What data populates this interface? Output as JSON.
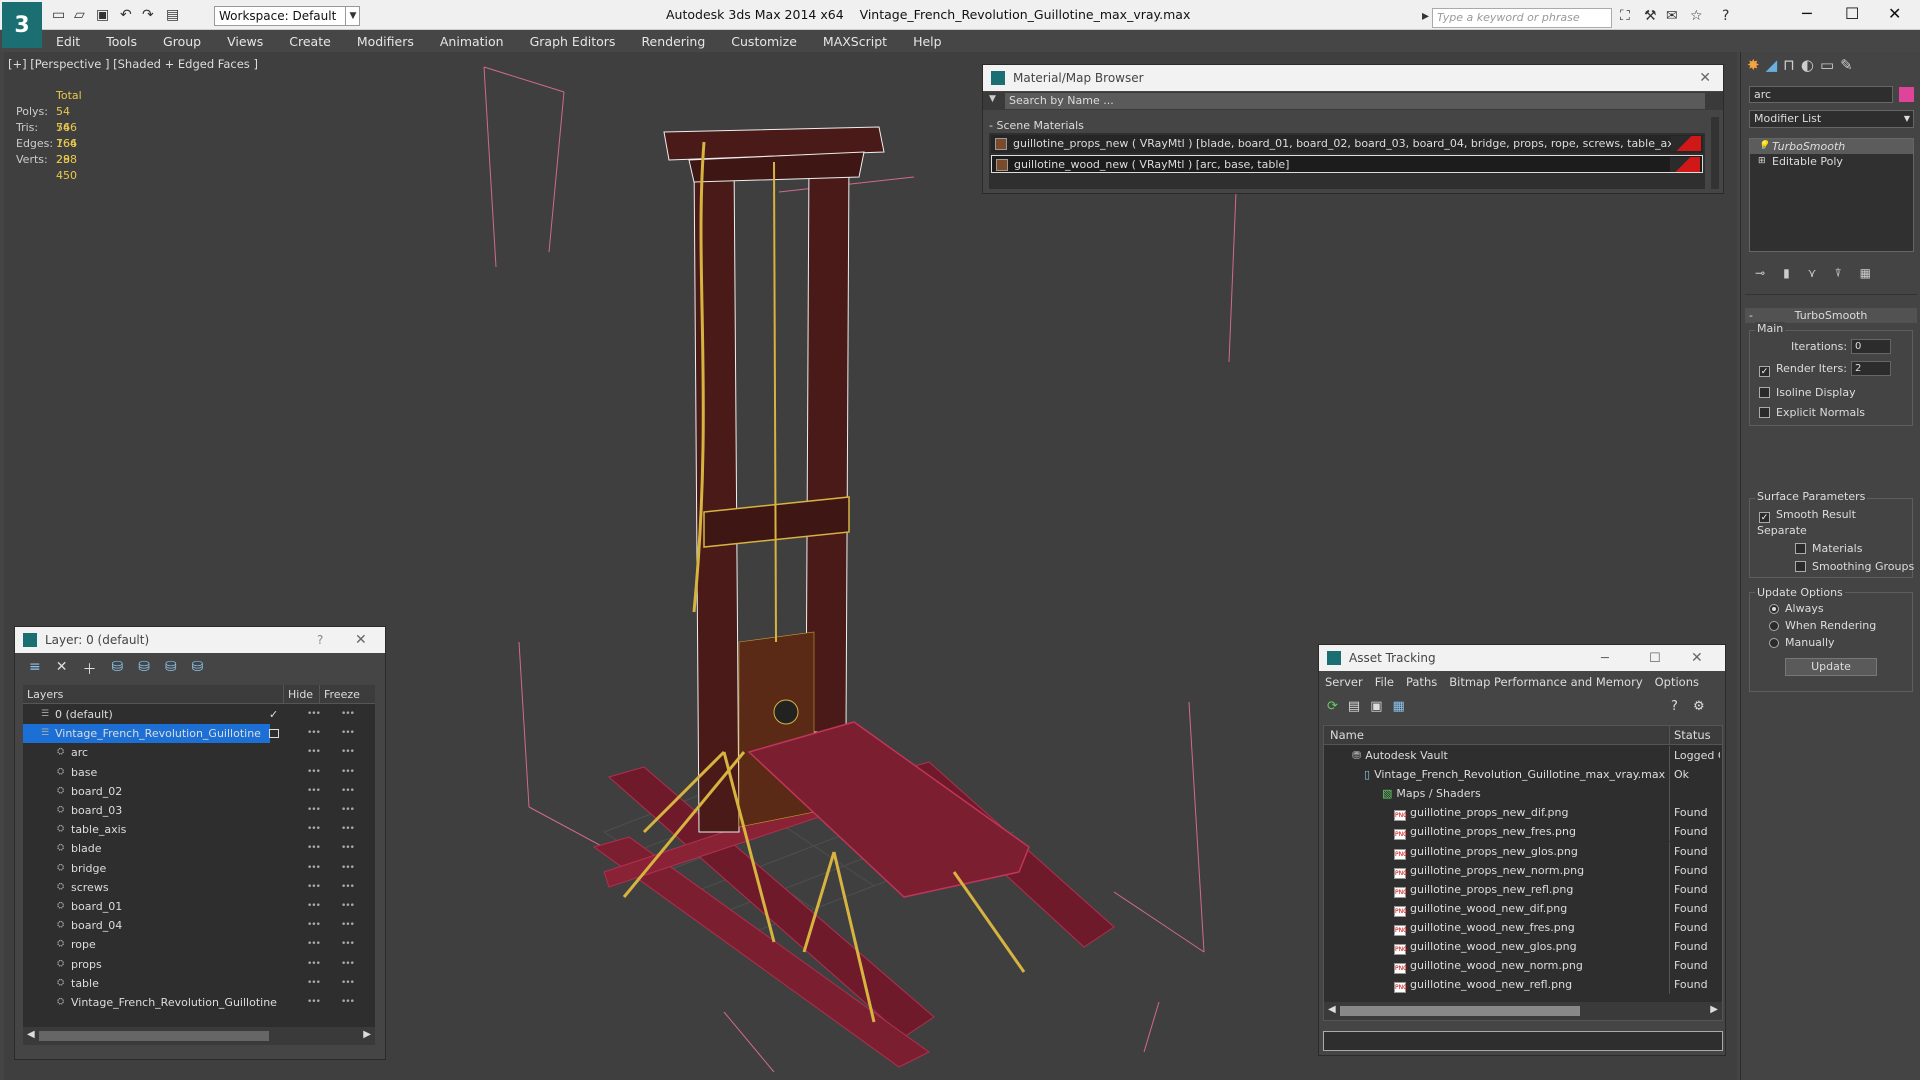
{
  "window": {
    "app_title": "Autodesk 3ds Max  2014 x64",
    "file_title": "Vintage_French_Revolution_Guillotine_max_vray.max",
    "workspace": "Workspace: Default",
    "search_placeholder": "Type a keyword or phrase"
  },
  "menu": [
    "Edit",
    "Tools",
    "Group",
    "Views",
    "Create",
    "Modifiers",
    "Animation",
    "Graph Editors",
    "Rendering",
    "Customize",
    "MAXScript",
    "Help"
  ],
  "viewport": {
    "label": "[+] [Perspective ] [Shaded + Edged Faces ]",
    "stats_header": "Total",
    "stats": [
      {
        "label": "Polys:",
        "value": "54 766"
      },
      {
        "label": "Tris:",
        "value": "54 766"
      },
      {
        "label": "Edges:",
        "value": "164 298"
      },
      {
        "label": "Verts:",
        "value": "28 450"
      }
    ]
  },
  "material_browser": {
    "title": "Material/Map Browser",
    "search_placeholder": "Search by Name ...",
    "section": "- Scene Materials",
    "items": [
      "guillotine_props_new  ( VRayMtl ) [blade, board_01, board_02, board_03, board_04, bridge, props, rope, screws, table_axis]",
      "guillotine_wood_new  ( VRayMtl ) [arc, base, table]"
    ]
  },
  "command_panel": {
    "name_field": "arc",
    "modifier_list": "Modifier List",
    "stack": [
      "TurboSmooth",
      "Editable Poly"
    ],
    "rollout_title": "TurboSmooth",
    "main_label": "Main",
    "iterations_label": "Iterations:",
    "iterations_value": "0",
    "render_iters_label": "Render Iters:",
    "render_iters_value": "2",
    "isoline": "Isoline Display",
    "explicit_normals": "Explicit Normals",
    "surface_params": "Surface Parameters",
    "smooth_result": "Smooth Result",
    "separate": "Separate",
    "materials": "Materials",
    "smoothing_groups": "Smoothing Groups",
    "update_options": "Update Options",
    "always": "Always",
    "when_rendering": "When Rendering",
    "manually": "Manually",
    "update_button": "Update"
  },
  "layer_panel": {
    "title": "Layer: 0 (default)",
    "help": "?",
    "col_layers": "Layers",
    "col_hide": "Hide",
    "col_freeze": "Freeze",
    "layers": [
      {
        "name": "0 (default)",
        "indent": 0
      },
      {
        "name": "Vintage_French_Revolution_Guillotine",
        "indent": 0
      },
      {
        "name": "arc",
        "indent": 1
      },
      {
        "name": "base",
        "indent": 1
      },
      {
        "name": "board_02",
        "indent": 1
      },
      {
        "name": "board_03",
        "indent": 1
      },
      {
        "name": "table_axis",
        "indent": 1
      },
      {
        "name": "blade",
        "indent": 1
      },
      {
        "name": "bridge",
        "indent": 1
      },
      {
        "name": "screws",
        "indent": 1
      },
      {
        "name": "board_01",
        "indent": 1
      },
      {
        "name": "board_04",
        "indent": 1
      },
      {
        "name": "rope",
        "indent": 1
      },
      {
        "name": "props",
        "indent": 1
      },
      {
        "name": "table",
        "indent": 1
      },
      {
        "name": "Vintage_French_Revolution_Guillotine",
        "indent": 1
      }
    ]
  },
  "asset_tracking": {
    "title": "Asset Tracking",
    "menu": [
      "Server",
      "File",
      "Paths",
      "Bitmap Performance and Memory",
      "Options"
    ],
    "col_name": "Name",
    "col_status": "Status",
    "rows": [
      {
        "name": "Autodesk Vault",
        "status": "Logged C",
        "indent": 0
      },
      {
        "name": "Vintage_French_Revolution_Guillotine_max_vray.max",
        "status": "Ok",
        "indent": 1
      },
      {
        "name": "Maps / Shaders",
        "status": "",
        "indent": 2
      },
      {
        "name": "guillotine_props_new_dif.png",
        "status": "Found",
        "indent": 3
      },
      {
        "name": "guillotine_props_new_fres.png",
        "status": "Found",
        "indent": 3
      },
      {
        "name": "guillotine_props_new_glos.png",
        "status": "Found",
        "indent": 3
      },
      {
        "name": "guillotine_props_new_norm.png",
        "status": "Found",
        "indent": 3
      },
      {
        "name": "guillotine_props_new_refl.png",
        "status": "Found",
        "indent": 3
      },
      {
        "name": "guillotine_wood_new_dif.png",
        "status": "Found",
        "indent": 3
      },
      {
        "name": "guillotine_wood_new_fres.png",
        "status": "Found",
        "indent": 3
      },
      {
        "name": "guillotine_wood_new_glos.png",
        "status": "Found",
        "indent": 3
      },
      {
        "name": "guillotine_wood_new_norm.png",
        "status": "Found",
        "indent": 3
      },
      {
        "name": "guillotine_wood_new_refl.png",
        "status": "Found",
        "indent": 3
      }
    ]
  }
}
